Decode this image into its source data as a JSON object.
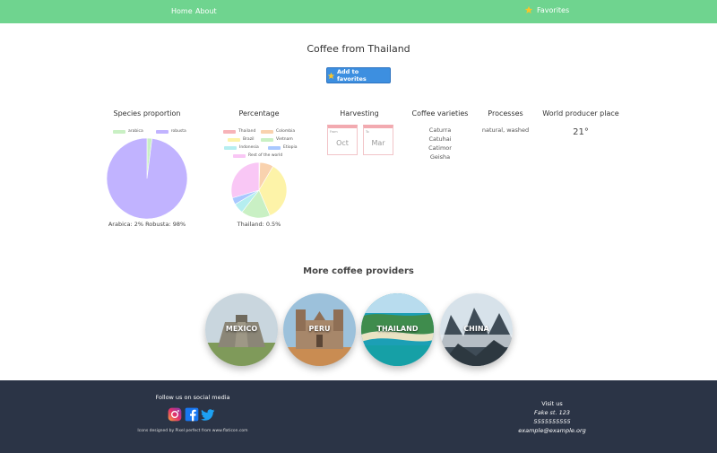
{
  "nav": {
    "home_label": "Home",
    "about_label": "About",
    "favorites_label": "Favorites"
  },
  "page": {
    "title": "Coffee from Thailand",
    "add_favorites_label": "Add to favorites"
  },
  "species": {
    "heading": "Species proportion",
    "legend": [
      {
        "label": "arabica",
        "color": "#c9f0c4"
      },
      {
        "label": "robusta",
        "color": "#c1b3ff"
      }
    ],
    "caption": "Arabica: 2% Robusta: 98%"
  },
  "percentage": {
    "heading": "Percentage",
    "legend": [
      {
        "label": "Thailand",
        "color": "#f7b3b8"
      },
      {
        "label": "Colombia",
        "color": "#f9d2ae"
      },
      {
        "label": "Brazil",
        "color": "#fdf3a8"
      },
      {
        "label": "Vietnam",
        "color": "#c9f0c4"
      },
      {
        "label": "Indonesia",
        "color": "#b5eef0"
      },
      {
        "label": "Etiopia",
        "color": "#a9c8ff"
      },
      {
        "label": "Rest of the world",
        "color": "#f9c7f5"
      }
    ],
    "caption": "Thailand: 0.5%"
  },
  "chart_data": [
    {
      "type": "pie",
      "title": "Species proportion",
      "categories": [
        "arabica",
        "robusta"
      ],
      "values": [
        2,
        98
      ]
    },
    {
      "type": "pie",
      "title": "Percentage",
      "categories": [
        "Thailand",
        "Colombia",
        "Brazil",
        "Vietnam",
        "Indonesia",
        "Etiopia",
        "Rest of the world"
      ],
      "values": [
        0.5,
        8,
        35,
        17,
        6,
        4,
        29.5
      ]
    }
  ],
  "harvesting": {
    "heading": "Harvesting",
    "from_label": "From",
    "from_value": "Oct",
    "to_label": "To",
    "to_value": "Mar"
  },
  "varieties": {
    "heading": "Coffee varieties",
    "items": [
      "Caturra",
      "Catuhai",
      "Catimor",
      "Geisha"
    ]
  },
  "processes": {
    "heading": "Processes",
    "value": "natural, washed"
  },
  "world_place": {
    "heading": "World producer place",
    "value": "21°"
  },
  "more": {
    "title": "More coffee providers",
    "providers": [
      {
        "label": "MEXICO"
      },
      {
        "label": "PERU"
      },
      {
        "label": "THAILAND"
      },
      {
        "label": "CHINA"
      }
    ]
  },
  "footer": {
    "follow_label": "Follow us on social media",
    "credits": "Icons designed by Pixel perfect from www.flaticon.com",
    "visit_label": "Visit us",
    "address": "Fake st. 123",
    "phone": "5555555555",
    "email": "example@example.org"
  },
  "colors": {
    "header": "#6fd48f",
    "button": "#3d8fe0",
    "footer": "#2b3446"
  }
}
